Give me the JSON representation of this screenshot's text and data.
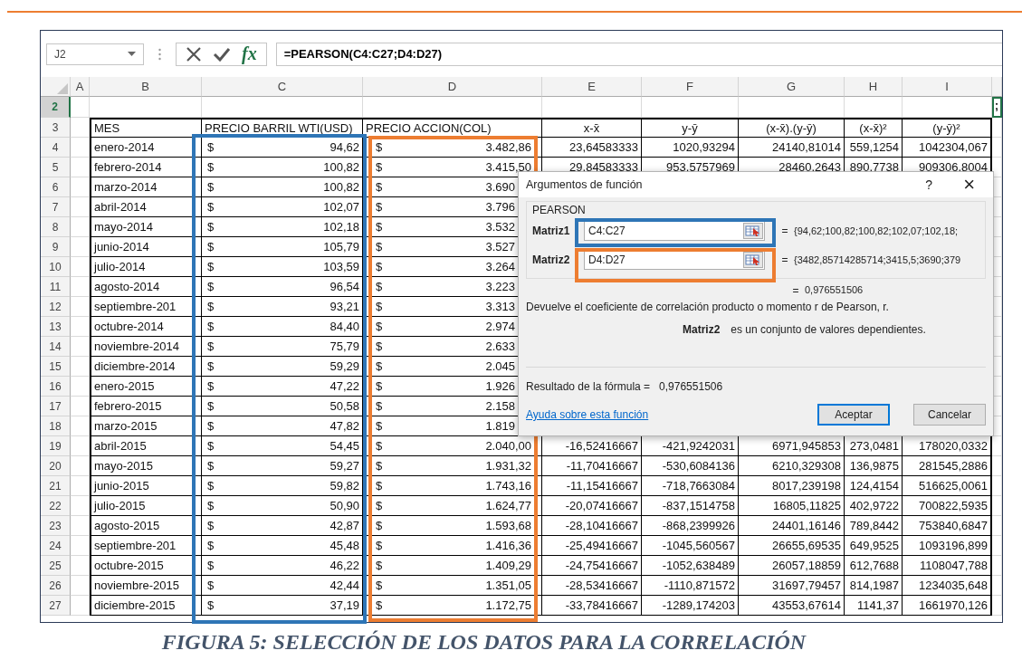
{
  "name_box": "J2",
  "fx_symbol": "fx",
  "formula": "=PEARSON(C4:C27;D4:D27)",
  "columns": [
    {
      "label": "A",
      "selected": false
    },
    {
      "label": "B",
      "selected": false
    },
    {
      "label": "C",
      "selected": false
    },
    {
      "label": "D",
      "selected": false
    },
    {
      "label": "E",
      "selected": false
    },
    {
      "label": "F",
      "selected": false
    },
    {
      "label": "G",
      "selected": false
    },
    {
      "label": "H",
      "selected": false
    },
    {
      "label": "I",
      "selected": false
    }
  ],
  "active_row": {
    "row": "2",
    "selected": true,
    "overflow_text": ";"
  },
  "header_row": {
    "row": "3",
    "cells": [
      "MES",
      "PRECIO BARRIL WTI(USD)",
      "PRECIO ACCION(COL)",
      "x-x̄",
      "y-ȳ",
      "(x-x̄).(y-ȳ)",
      "(x-x̄)²",
      "(y-ȳ)²"
    ]
  },
  "rows": [
    {
      "row": "4",
      "month": "enero-2014",
      "c_symbol": "$",
      "c_value": "94,62",
      "d_symbol": "$",
      "d_value": "3.482,86",
      "stats": [
        "23,64583333",
        "1020,93294",
        "24140,81014",
        "559,1254",
        "1042304,067"
      ]
    },
    {
      "row": "5",
      "month": "febrero-2014",
      "c_symbol": "$",
      "c_value": "100,82",
      "d_symbol": "$",
      "d_value": "3.415,50",
      "stats": [
        "29,84583333",
        "953,5757969",
        "28460,2643",
        "890,7738",
        "909306,8004"
      ]
    },
    {
      "row": "6",
      "month": "marzo-2014",
      "c_symbol": "$",
      "c_value": "100,82",
      "d_symbol": "$",
      "d_value": "3.690"
    },
    {
      "row": "7",
      "month": "abril-2014",
      "c_symbol": "$",
      "c_value": "102,07",
      "d_symbol": "$",
      "d_value": "3.796"
    },
    {
      "row": "8",
      "month": "mayo-2014",
      "c_symbol": "$",
      "c_value": "102,18",
      "d_symbol": "$",
      "d_value": "3.532"
    },
    {
      "row": "9",
      "month": "junio-2014",
      "c_symbol": "$",
      "c_value": "105,79",
      "d_symbol": "$",
      "d_value": "3.527"
    },
    {
      "row": "10",
      "month": "julio-2014",
      "c_symbol": "$",
      "c_value": "103,59",
      "d_symbol": "$",
      "d_value": "3.264"
    },
    {
      "row": "11",
      "month": "agosto-2014",
      "c_symbol": "$",
      "c_value": "96,54",
      "d_symbol": "$",
      "d_value": "3.223"
    },
    {
      "row": "12",
      "month": "septiembre-201",
      "c_symbol": "$",
      "c_value": "93,21",
      "d_symbol": "$",
      "d_value": "3.313"
    },
    {
      "row": "13",
      "month": "octubre-2014",
      "c_symbol": "$",
      "c_value": "84,40",
      "d_symbol": "$",
      "d_value": "2.974"
    },
    {
      "row": "14",
      "month": "noviembre-2014",
      "c_symbol": "$",
      "c_value": "75,79",
      "d_symbol": "$",
      "d_value": "2.633"
    },
    {
      "row": "15",
      "month": "diciembre-2014",
      "c_symbol": "$",
      "c_value": "59,29",
      "d_symbol": "$",
      "d_value": "2.045"
    },
    {
      "row": "16",
      "month": "enero-2015",
      "c_symbol": "$",
      "c_value": "47,22",
      "d_symbol": "$",
      "d_value": "1.926"
    },
    {
      "row": "17",
      "month": "febrero-2015",
      "c_symbol": "$",
      "c_value": "50,58",
      "d_symbol": "$",
      "d_value": "2.158"
    },
    {
      "row": "18",
      "month": "marzo-2015",
      "c_symbol": "$",
      "c_value": "47,82",
      "d_symbol": "$",
      "d_value": "1.819"
    },
    {
      "row": "19",
      "month": "abril-2015",
      "c_symbol": "$",
      "c_value": "54,45",
      "d_symbol": "$",
      "d_value": "2.040,00",
      "stats": [
        "-16,52416667",
        "-421,9242031",
        "6971,945853",
        "273,0481",
        "178020,0332"
      ]
    },
    {
      "row": "20",
      "month": "mayo-2015",
      "c_symbol": "$",
      "c_value": "59,27",
      "d_symbol": "$",
      "d_value": "1.931,32",
      "stats": [
        "-11,70416667",
        "-530,6084136",
        "6210,329308",
        "136,9875",
        "281545,2886"
      ]
    },
    {
      "row": "21",
      "month": "junio-2015",
      "c_symbol": "$",
      "c_value": "59,82",
      "d_symbol": "$",
      "d_value": "1.743,16",
      "stats": [
        "-11,15416667",
        "-718,7663084",
        "8017,239198",
        "124,4154",
        "516625,0061"
      ]
    },
    {
      "row": "22",
      "month": "julio-2015",
      "c_symbol": "$",
      "c_value": "50,90",
      "d_symbol": "$",
      "d_value": "1.624,77",
      "stats": [
        "-20,07416667",
        "-837,1514758",
        "16805,11825",
        "402,9722",
        "700822,5935"
      ]
    },
    {
      "row": "23",
      "month": "agosto-2015",
      "c_symbol": "$",
      "c_value": "42,87",
      "d_symbol": "$",
      "d_value": "1.593,68",
      "stats": [
        "-28,10416667",
        "-868,2399926",
        "24401,16146",
        "789,8442",
        "753840,6847"
      ]
    },
    {
      "row": "24",
      "month": "septiembre-201",
      "c_symbol": "$",
      "c_value": "45,48",
      "d_symbol": "$",
      "d_value": "1.416,36",
      "stats": [
        "-25,49416667",
        "-1045,560567",
        "26655,69535",
        "649,9525",
        "1093196,899"
      ]
    },
    {
      "row": "25",
      "month": "octubre-2015",
      "c_symbol": "$",
      "c_value": "46,22",
      "d_symbol": "$",
      "d_value": "1.409,29",
      "stats": [
        "-24,75416667",
        "-1052,638489",
        "26057,18859",
        "612,7688",
        "1108047,788"
      ]
    },
    {
      "row": "26",
      "month": "noviembre-2015",
      "c_symbol": "$",
      "c_value": "42,44",
      "d_symbol": "$",
      "d_value": "1.351,05",
      "stats": [
        "-28,53416667",
        "-1110,871572",
        "31697,79457",
        "814,1987",
        "1234035,648"
      ]
    },
    {
      "row": "27",
      "month": "diciembre-2015",
      "c_symbol": "$",
      "c_value": "37,19",
      "d_symbol": "$",
      "d_value": "1.172,75",
      "stats": [
        "-33,78416667",
        "-1289,174203",
        "43553,67614",
        "1141,37",
        "1661970,126"
      ]
    }
  ],
  "dialog": {
    "title": "Argumentos de función",
    "help": "?",
    "close": "×",
    "function_name": "PEARSON",
    "arguments": [
      {
        "label": "Matriz1",
        "value": "C4:C27",
        "equals": "=",
        "preview": "{94,62;100,82;100,82;102,07;102,18;"
      },
      {
        "label": "Matriz2",
        "value": "D4:D27",
        "equals": "=",
        "preview": "{3482,85714285714;3415,5;3690;379"
      }
    ],
    "result_equals": "=",
    "result_preview": "0,976551506",
    "description": "Devuelve el coeficiente de correlación producto o momento r de Pearson, r.",
    "argument_name": "Matriz2",
    "argument_description": "es un conjunto de valores dependientes.",
    "result_label": "Resultado de la fórmula =",
    "result_value": "0,976551506",
    "help_link": "Ayuda sobre esta función",
    "buttons": [
      {
        "label": "Aceptar",
        "selected": true
      },
      {
        "label": "Cancelar",
        "selected": false
      }
    ]
  },
  "caption": "FIGURA 5: SELECCIÓN DE LOS DATOS PARA LA CORRELACIÓN"
}
